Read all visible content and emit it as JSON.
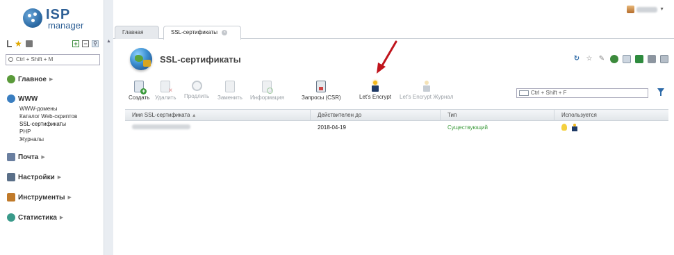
{
  "brand": {
    "logo_isp": "ISP",
    "logo_manager": "manager"
  },
  "user": {
    "name": ""
  },
  "left": {
    "search_placeholder": "Ctrl + Shift + M",
    "menu": [
      {
        "label": "Главное",
        "icon": "home-icon",
        "color": "#5a9a3a"
      },
      {
        "label": "WWW",
        "icon": "globe-icon",
        "color": "#3a7ec0",
        "items": [
          "WWW-домены",
          "Каталог Web-скриптов",
          "SSL-сертификаты",
          "PHP",
          "Журналы"
        ]
      },
      {
        "label": "Почта",
        "icon": "mail-icon",
        "color": "#6a7fa0"
      },
      {
        "label": "Настройки",
        "icon": "settings-icon",
        "color": "#5a6f88"
      },
      {
        "label": "Инструменты",
        "icon": "tools-icon",
        "color": "#c07a2a"
      },
      {
        "label": "Статистика",
        "icon": "stats-icon",
        "color": "#3a9a8a"
      }
    ]
  },
  "tabs": [
    {
      "label": "Главная"
    },
    {
      "label": "SSL-сертификаты"
    }
  ],
  "page": {
    "title": "SSL-сертификаты"
  },
  "toolbar": {
    "create": "Создать",
    "delete": "Удалить",
    "renew": "Продлить",
    "replace": "Заменить",
    "info": "Информация",
    "csr": "Запросы (CSR)",
    "letsencrypt": "Let's Encrypt",
    "letsencrypt_log": "Let's Encrypt Журнал"
  },
  "search": {
    "placeholder": "Ctrl + Shift + F"
  },
  "table": {
    "columns": [
      "Имя SSL-сертификата",
      "Действителен до",
      "Тип",
      "Используется"
    ],
    "rows": [
      {
        "name": "",
        "valid_until": "2018-04-19",
        "type": "Существующий"
      }
    ]
  },
  "colors": {
    "accent": "#2d6aa8",
    "type_green": "#3a9a3a",
    "arrow_red": "#c0141c"
  }
}
